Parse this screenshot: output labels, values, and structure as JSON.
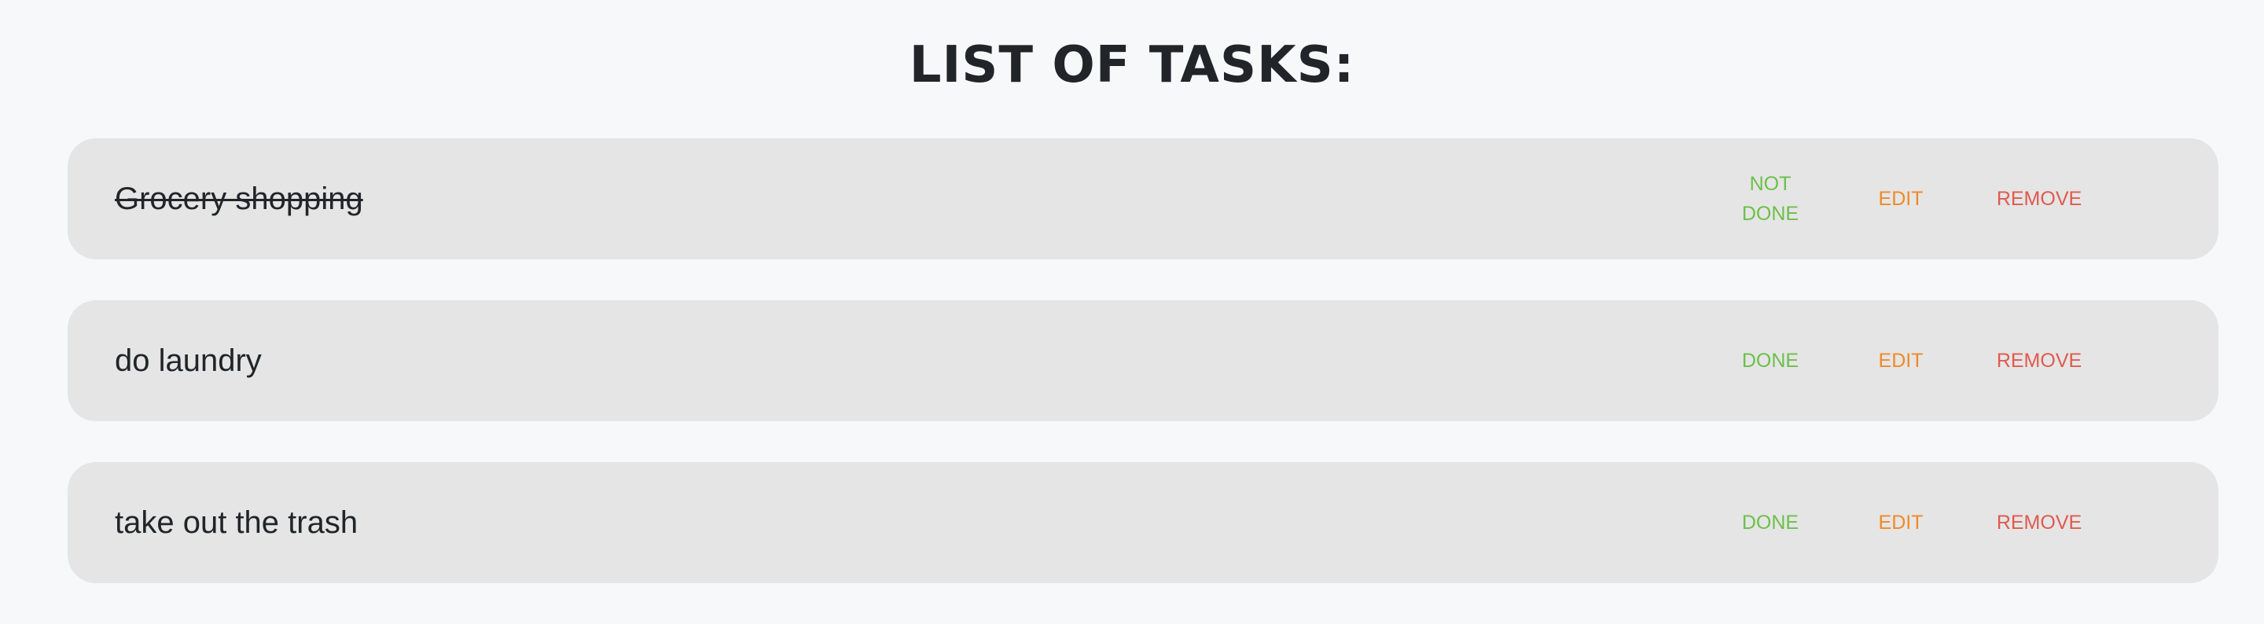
{
  "header": {
    "title": "LIST OF TASKS:"
  },
  "tasks": [
    {
      "name": "Grocery shopping",
      "completed": true,
      "toggle_label": "NOT\nDONE",
      "edit_label": "EDIT",
      "remove_label": "REMOVE"
    },
    {
      "name": "do laundry",
      "completed": false,
      "toggle_label": "DONE",
      "edit_label": "EDIT",
      "remove_label": "REMOVE"
    },
    {
      "name": "take out the trash",
      "completed": false,
      "toggle_label": "DONE",
      "edit_label": "EDIT",
      "remove_label": "REMOVE"
    }
  ],
  "colors": {
    "background": "#f7f8fa",
    "card": "#e5e5e5",
    "text": "#212529",
    "done_action": "#6cc04a",
    "edit_action": "#ee8a27",
    "remove_action": "#e05a4e"
  }
}
